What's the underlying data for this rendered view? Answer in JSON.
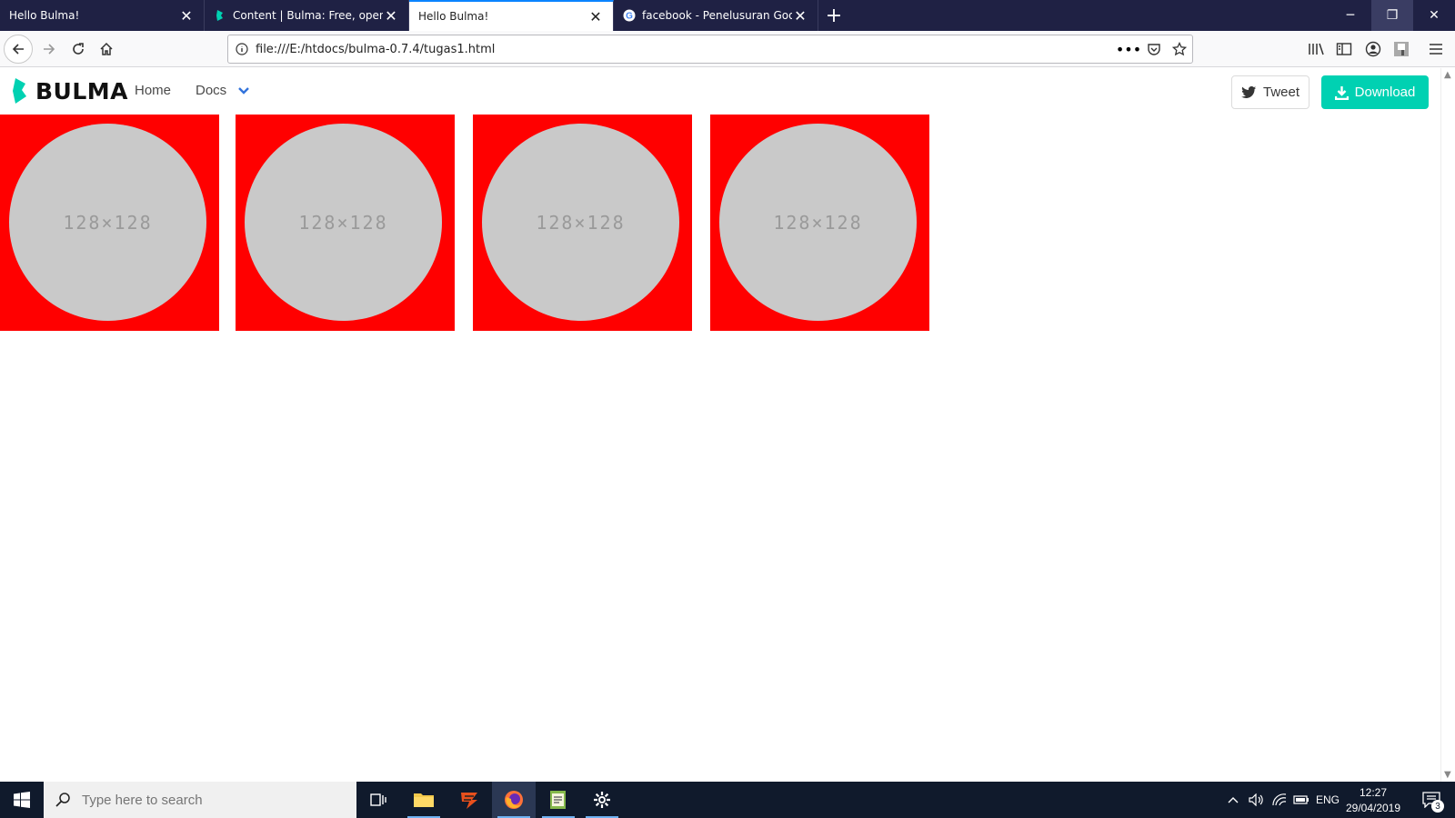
{
  "browser": {
    "tabs": [
      {
        "title": "Hello Bulma!",
        "favicon": "none",
        "active": false
      },
      {
        "title": "Content | Bulma: Free, open source",
        "favicon": "bulma-icon",
        "active": false
      },
      {
        "title": "Hello Bulma!",
        "favicon": "none",
        "active": true
      },
      {
        "title": "facebook - Penelusuran Google",
        "favicon": "google-icon",
        "active": false
      }
    ],
    "url": "file:///E:/htdocs/bulma-0.7.4/tugas1.html"
  },
  "page": {
    "brand": "BULMA",
    "nav": {
      "home": "Home",
      "docs": "Docs"
    },
    "buttons": {
      "tweet": "Tweet",
      "download": "Download"
    },
    "images": [
      {
        "label": "128×128"
      },
      {
        "label": "128×128"
      },
      {
        "label": "128×128"
      },
      {
        "label": "128×128"
      }
    ],
    "colors": {
      "tile": "#ff0000",
      "circle": "#c9c9c9",
      "accent": "#00d1b2"
    }
  },
  "taskbar": {
    "search_placeholder": "Type here to search",
    "language": "ENG",
    "time": "12:27",
    "date": "29/04/2019",
    "notifications": "3"
  }
}
